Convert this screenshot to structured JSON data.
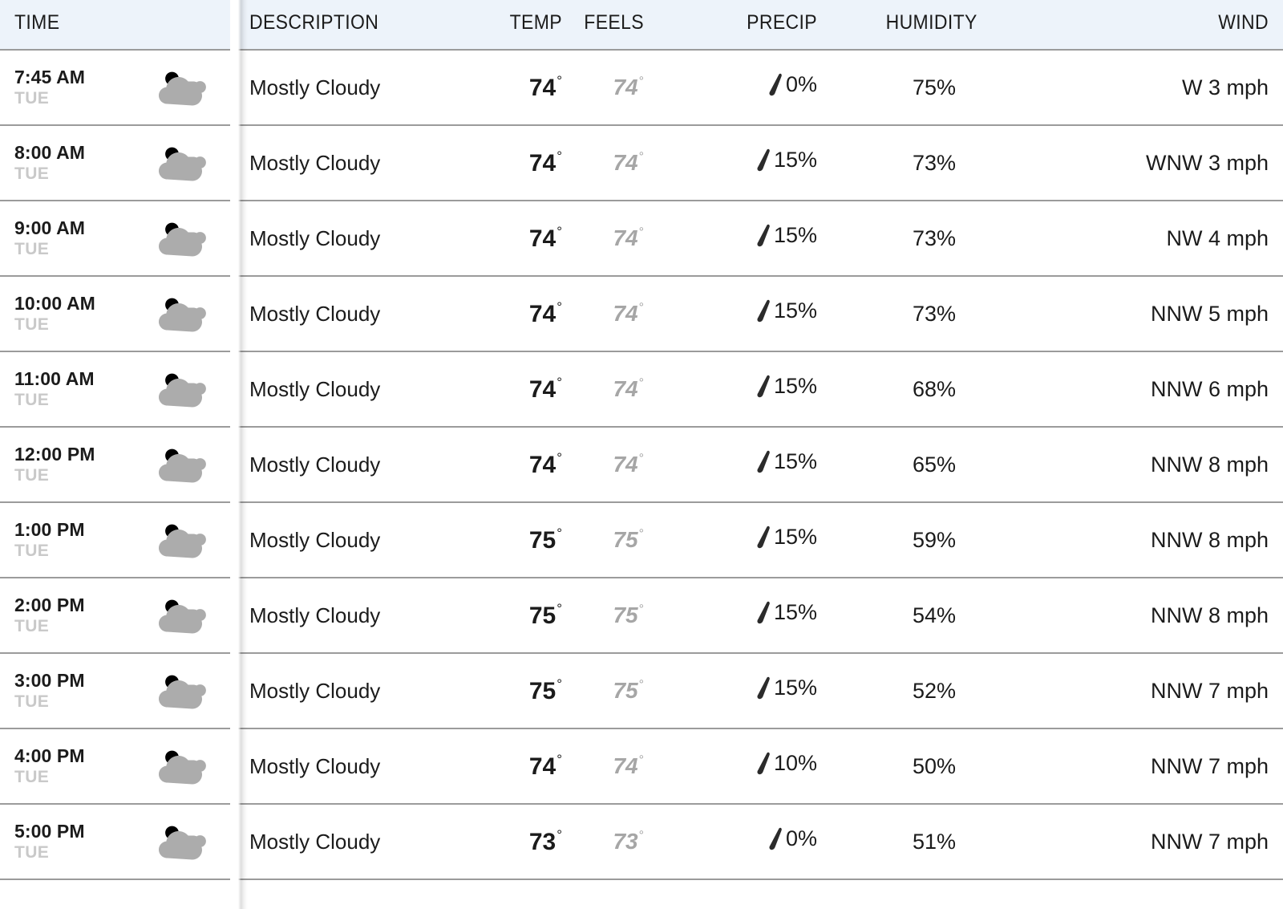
{
  "table": {
    "columns": [
      {
        "key": "time",
        "label": "TIME"
      },
      {
        "key": "description",
        "label": "DESCRIPTION"
      },
      {
        "key": "temp",
        "label": "TEMP"
      },
      {
        "key": "feels",
        "label": "FEELS"
      },
      {
        "key": "precip",
        "label": "PRECIP"
      },
      {
        "key": "humidity",
        "label": "HUMIDITY"
      },
      {
        "key": "wind",
        "label": "WIND"
      }
    ],
    "icons": {
      "condition": "sun-behind-cloud-icon",
      "precip": "raindrop-icon"
    },
    "units": {
      "degree": "°",
      "percent": "%",
      "speed": "mph"
    },
    "rows": [
      {
        "time": "7:45 AM",
        "day": "TUE",
        "icon": "sun-behind-cloud-icon",
        "description": "Mostly Cloudy",
        "temp": "74",
        "temp_deg": "°",
        "feels": "74",
        "feels_deg": "°",
        "precip": "0%",
        "humidity": "75%",
        "wind": "W 3 mph"
      },
      {
        "time": "8:00 AM",
        "day": "TUE",
        "icon": "sun-behind-cloud-icon",
        "description": "Mostly Cloudy",
        "temp": "74",
        "temp_deg": "°",
        "feels": "74",
        "feels_deg": "°",
        "precip": "15%",
        "humidity": "73%",
        "wind": "WNW 3 mph"
      },
      {
        "time": "9:00 AM",
        "day": "TUE",
        "icon": "sun-behind-cloud-icon",
        "description": "Mostly Cloudy",
        "temp": "74",
        "temp_deg": "°",
        "feels": "74",
        "feels_deg": "°",
        "precip": "15%",
        "humidity": "73%",
        "wind": "NW 4 mph"
      },
      {
        "time": "10:00 AM",
        "day": "TUE",
        "icon": "sun-behind-cloud-icon",
        "description": "Mostly Cloudy",
        "temp": "74",
        "temp_deg": "°",
        "feels": "74",
        "feels_deg": "°",
        "precip": "15%",
        "humidity": "73%",
        "wind": "NNW 5 mph"
      },
      {
        "time": "11:00 AM",
        "day": "TUE",
        "icon": "sun-behind-cloud-icon",
        "description": "Mostly Cloudy",
        "temp": "74",
        "temp_deg": "°",
        "feels": "74",
        "feels_deg": "°",
        "precip": "15%",
        "humidity": "68%",
        "wind": "NNW 6 mph"
      },
      {
        "time": "12:00 PM",
        "day": "TUE",
        "icon": "sun-behind-cloud-icon",
        "description": "Mostly Cloudy",
        "temp": "74",
        "temp_deg": "°",
        "feels": "74",
        "feels_deg": "°",
        "precip": "15%",
        "humidity": "65%",
        "wind": "NNW 8 mph"
      },
      {
        "time": "1:00 PM",
        "day": "TUE",
        "icon": "sun-behind-cloud-icon",
        "description": "Mostly Cloudy",
        "temp": "75",
        "temp_deg": "°",
        "feels": "75",
        "feels_deg": "°",
        "precip": "15%",
        "humidity": "59%",
        "wind": "NNW 8 mph"
      },
      {
        "time": "2:00 PM",
        "day": "TUE",
        "icon": "sun-behind-cloud-icon",
        "description": "Mostly Cloudy",
        "temp": "75",
        "temp_deg": "°",
        "feels": "75",
        "feels_deg": "°",
        "precip": "15%",
        "humidity": "54%",
        "wind": "NNW 8 mph"
      },
      {
        "time": "3:00 PM",
        "day": "TUE",
        "icon": "sun-behind-cloud-icon",
        "description": "Mostly Cloudy",
        "temp": "75",
        "temp_deg": "°",
        "feels": "75",
        "feels_deg": "°",
        "precip": "15%",
        "humidity": "52%",
        "wind": "NNW 7 mph"
      },
      {
        "time": "4:00 PM",
        "day": "TUE",
        "icon": "sun-behind-cloud-icon",
        "description": "Mostly Cloudy",
        "temp": "74",
        "temp_deg": "°",
        "feels": "74",
        "feels_deg": "°",
        "precip": "10%",
        "humidity": "50%",
        "wind": "NNW 7 mph"
      },
      {
        "time": "5:00 PM",
        "day": "TUE",
        "icon": "sun-behind-cloud-icon",
        "description": "Mostly Cloudy",
        "temp": "73",
        "temp_deg": "°",
        "feels": "73",
        "feels_deg": "°",
        "precip": "0%",
        "humidity": "51%",
        "wind": "NNW 7 mph"
      }
    ]
  },
  "colors": {
    "header_background": "#edf3fa",
    "row_border": "#9b9b9b",
    "text_primary": "#1b1b1b",
    "text_muted": "#c9c9c9",
    "feels_text": "#a6a6a6",
    "cloud_gray": "#acacac",
    "sun_yellow": "#e8c020",
    "raindrop": "#2b2b2b",
    "page_background": "#ffffff"
  }
}
